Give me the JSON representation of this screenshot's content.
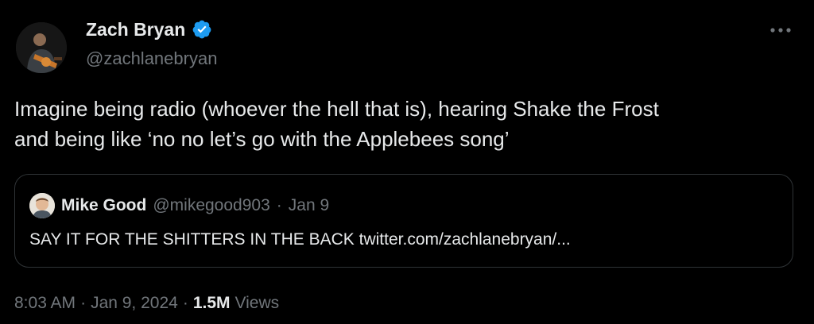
{
  "author": {
    "name": "Zach Bryan",
    "handle": "@zachlanebryan",
    "verified": true
  },
  "tweet": {
    "text_line1": "Imagine being radio (whoever the hell that is), hearing Shake the Frost",
    "text_line2": "and being like ‘no no let’s go with the Applebees song’"
  },
  "quote": {
    "name": "Mike Good",
    "handle": "@mikegood903",
    "separator": "·",
    "date": "Jan 9",
    "text": "SAY IT FOR THE SHITTERS IN THE BACK twitter.com/zachlanebryan/..."
  },
  "meta": {
    "time": "8:03 AM",
    "sep1": "·",
    "date": "Jan 9, 2024",
    "sep2": "·",
    "views_count": "1.5M",
    "views_label": "Views"
  },
  "colors": {
    "background": "#000000",
    "text": "#e7e9ea",
    "secondary": "#71767b",
    "verified": "#1d9bf0",
    "border": "#2f3336"
  },
  "icons": {
    "verified": "verified-badge-icon",
    "more": "more-options-icon"
  }
}
